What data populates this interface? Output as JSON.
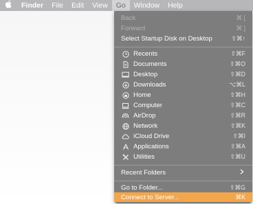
{
  "menubar": {
    "apple_icon": "",
    "items": [
      "Finder",
      "File",
      "Edit",
      "View",
      "Go",
      "Window",
      "Help"
    ],
    "active": "Go"
  },
  "go_menu": {
    "back": {
      "label": "Back",
      "shortcut": "⌘ ["
    },
    "forward": {
      "label": "Forward",
      "shortcut": "⌘ ]"
    },
    "startup": {
      "label": "Select Startup Disk on Desktop",
      "shortcut": "⇧⌘↑"
    },
    "places": [
      {
        "label": "Recents",
        "shortcut": "⇧⌘F",
        "icon": "clock-icon"
      },
      {
        "label": "Documents",
        "shortcut": "⇧⌘O",
        "icon": "document-icon"
      },
      {
        "label": "Desktop",
        "shortcut": "⇧⌘D",
        "icon": "desktop-icon"
      },
      {
        "label": "Downloads",
        "shortcut": "⌥⌘L",
        "icon": "download-icon"
      },
      {
        "label": "Home",
        "shortcut": "⇧⌘H",
        "icon": "home-icon"
      },
      {
        "label": "Computer",
        "shortcut": "⇧⌘C",
        "icon": "computer-icon"
      },
      {
        "label": "AirDrop",
        "shortcut": "⇧⌘R",
        "icon": "airdrop-icon"
      },
      {
        "label": "Network",
        "shortcut": "⇧⌘K",
        "icon": "network-icon"
      },
      {
        "label": "iCloud Drive",
        "shortcut": "⇧⌘I",
        "icon": "cloud-icon"
      },
      {
        "label": "Applications",
        "shortcut": "⇧⌘A",
        "icon": "applications-icon"
      },
      {
        "label": "Utilities",
        "shortcut": "⇧⌘U",
        "icon": "utilities-icon"
      }
    ],
    "recent_folders": {
      "label": "Recent Folders"
    },
    "go_to_folder": {
      "label": "Go to Folder...",
      "shortcut": "⇧⌘G"
    },
    "connect": {
      "label": "Connect to Server...",
      "shortcut": "⌘K"
    }
  },
  "colors": {
    "menu_bg": "#7d7d7d",
    "highlight": "#f3a64a",
    "menubar_bg": "#b7b7b9"
  }
}
